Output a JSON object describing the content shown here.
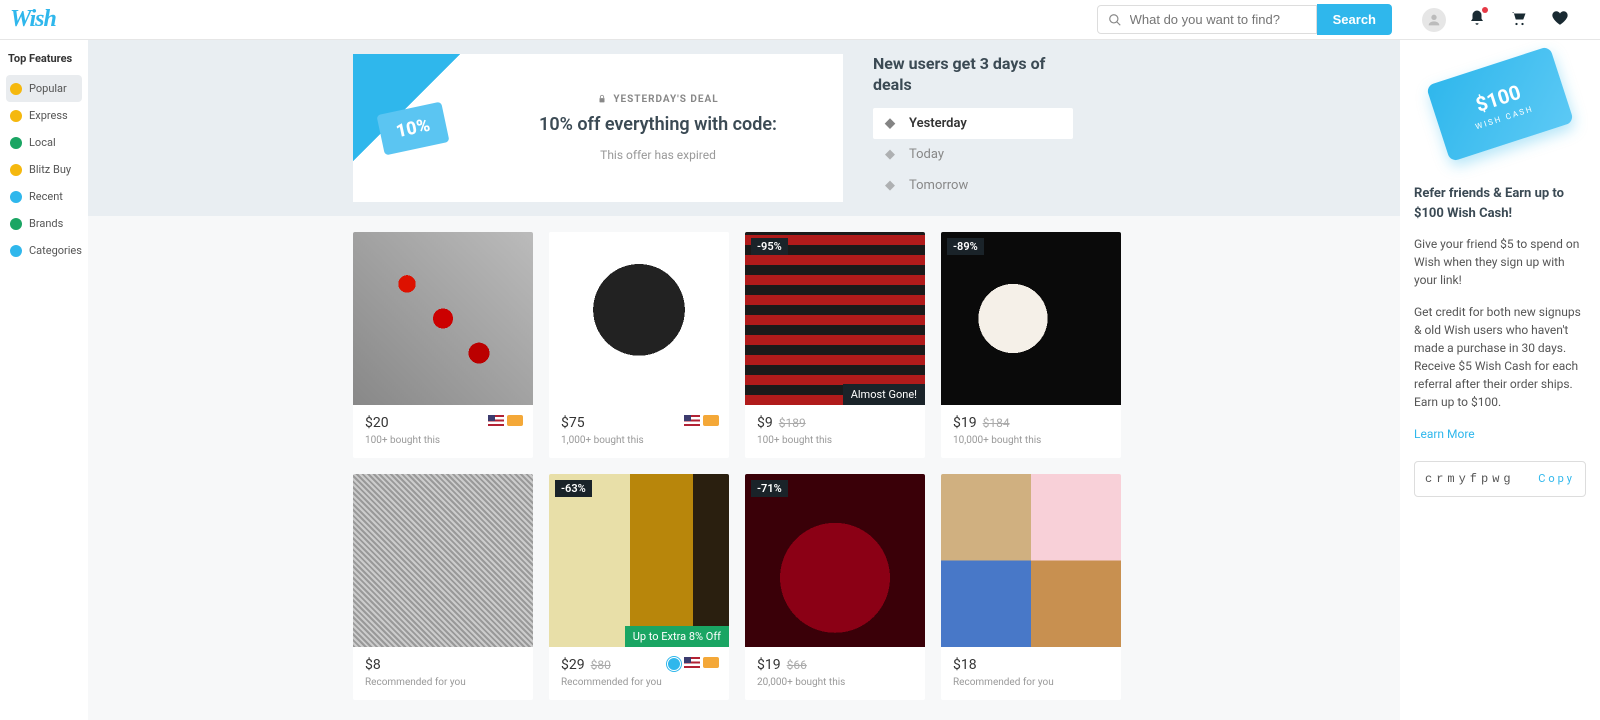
{
  "header": {
    "logo": "Wish",
    "search_placeholder": "What do you want to find?",
    "search_button": "Search"
  },
  "sidebar": {
    "title": "Top Features",
    "items": [
      {
        "label": "Popular",
        "color": "#f5b80e",
        "active": true
      },
      {
        "label": "Express",
        "color": "#f5b80e",
        "active": false
      },
      {
        "label": "Local",
        "color": "#1aa563",
        "active": false
      },
      {
        "label": "Blitz Buy",
        "color": "#f5b80e",
        "active": false
      },
      {
        "label": "Recent",
        "color": "#2fb7ec",
        "active": false
      },
      {
        "label": "Brands",
        "color": "#1aa563",
        "active": false
      },
      {
        "label": "Categories",
        "color": "#2fb7ec",
        "active": false
      }
    ]
  },
  "promo": {
    "ticket": "10%",
    "eyebrow": "YESTERDAY'S DEAL",
    "title": "10% off everything with code:",
    "expired": "This offer has expired",
    "side_heading": "New users get 3 days of deals",
    "tabs": [
      {
        "label": "Yesterday",
        "active": true
      },
      {
        "label": "Today",
        "active": false
      },
      {
        "label": "Tomorrow",
        "active": false
      }
    ]
  },
  "products": [
    {
      "img": "img-knives",
      "price": "$20",
      "orig": "",
      "meta": "100+ bought this",
      "flags": true,
      "verified": false,
      "badge_tl": "",
      "badge_br": "",
      "badge_green": ""
    },
    {
      "img": "img-gun",
      "price": "$75",
      "orig": "",
      "meta": "1,000+ bought this",
      "flags": true,
      "verified": false,
      "badge_tl": "",
      "badge_br": "",
      "badge_green": ""
    },
    {
      "img": "img-plaid",
      "price": "$9",
      "orig": "$189",
      "meta": "100+ bought this",
      "flags": false,
      "verified": false,
      "badge_tl": "-95%",
      "badge_br": "Almost Gone!",
      "badge_green": ""
    },
    {
      "img": "img-hoodie",
      "price": "$19",
      "orig": "$184",
      "meta": "10,000+ bought this",
      "flags": false,
      "verified": false,
      "badge_tl": "-89%",
      "badge_br": "",
      "badge_green": ""
    },
    {
      "img": "img-vneck",
      "price": "$8",
      "orig": "",
      "meta": "Recommended for you",
      "flags": false,
      "verified": false,
      "badge_tl": "",
      "badge_br": "",
      "badge_green": ""
    },
    {
      "img": "img-perfume",
      "price": "$29",
      "orig": "$80",
      "meta": "Recommended for you",
      "flags": true,
      "verified": true,
      "badge_tl": "-63%",
      "badge_br": "",
      "badge_green": "Up to Extra 8% Off"
    },
    {
      "img": "img-bedding-red",
      "price": "$19",
      "orig": "$66",
      "meta": "20,000+ bought this",
      "flags": false,
      "verified": false,
      "badge_tl": "-71%",
      "badge_br": "",
      "badge_green": ""
    },
    {
      "img": "img-bedding-multi",
      "price": "$18",
      "orig": "",
      "meta": "Recommended for you",
      "flags": false,
      "verified": false,
      "badge_tl": "",
      "badge_br": "",
      "badge_green": ""
    }
  ],
  "refer": {
    "card_amount": "$100",
    "card_sub": "WISH CASH",
    "title": "Refer friends & Earn up to $100 Wish Cash!",
    "p1": "Give your friend $5 to spend on Wish when they sign up with your link!",
    "p2": "Get credit for both new signups & old Wish users who haven't made a purchase in 30 days. Receive $5 Wish Cash for each referral after their order ships. Earn up to $100.",
    "learn_more": "Learn More",
    "code": "crmyfpwg",
    "copy": "Copy"
  }
}
